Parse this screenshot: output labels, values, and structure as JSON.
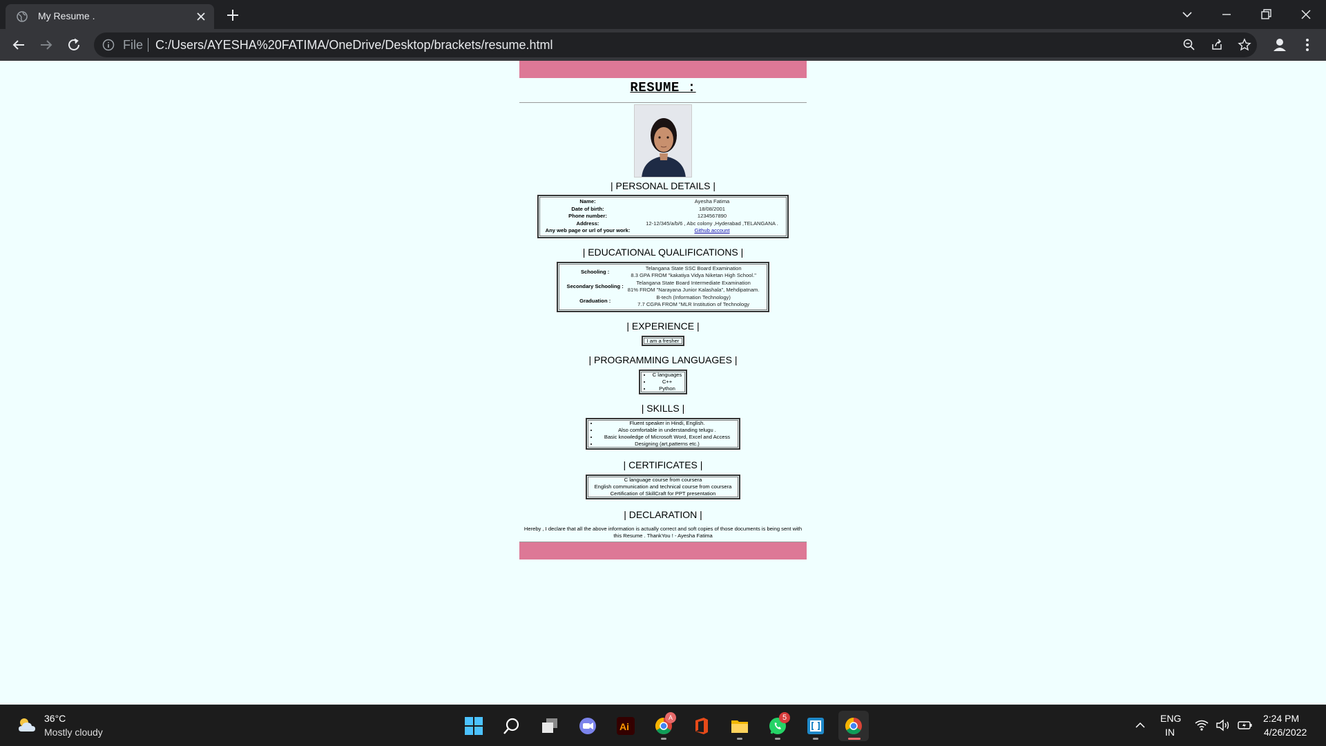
{
  "browser": {
    "tab_title": "My Resume .",
    "omnibox_scheme_label": "File",
    "url": "C:/Users/AYESHA%20FATIMA/OneDrive/Desktop/brackets/resume.html"
  },
  "resume": {
    "title": "RESUME :",
    "accent_color": "#dd7896",
    "personal": {
      "heading": "| PERSONAL DETAILS |",
      "rows": [
        {
          "label": "Name:",
          "value": "Ayesha Fatima"
        },
        {
          "label": "Date of birth:",
          "value": "18/08/2001"
        },
        {
          "label": "Phone number:",
          "value": "1234567890"
        },
        {
          "label": "Address:",
          "value": "12-12/345/a/b/6 , Abc colony ,Hyderabad ,TELANGANA ."
        },
        {
          "label": "Any web page or url of your work:",
          "value": "Github account"
        }
      ]
    },
    "education": {
      "heading": "| EDUCATIONAL QUALIFICATIONS |",
      "rows": [
        {
          "label": "Schooling :",
          "line1": "Telangana State SSC Board Examination",
          "line2": "8.3 GPA FROM \"kakatiya Vidya Niketan High School.\""
        },
        {
          "label": "Secondary Schooling :",
          "line1": "Telangana State Board Intermediate Examination",
          "line2": "81% FROM \"Narayana Junior Kalashala\", Mehdipatnam."
        },
        {
          "label": "Graduation :",
          "line1": "B-tech (Information Technology)",
          "line2": "7.7 CGPA FROM \"MLR Institution of Technology"
        }
      ]
    },
    "experience": {
      "heading": "| EXPERIENCE |",
      "text": "I am a fresher"
    },
    "languages": {
      "heading": "| PROGRAMMING LANGUAGES |",
      "items": [
        "C languages",
        "C++",
        "Python"
      ]
    },
    "skills": {
      "heading": "| SKILLS |",
      "items": [
        "Fluent speaker in Hindi, English.",
        "Also comfortable in understanding telugu .",
        "Basic knowledge of Microsoft Word, Excel and Access",
        "Designing (art,patterns etc.)"
      ]
    },
    "certificates": {
      "heading": "| CERTIFICATES |",
      "items": [
        "C language course from coursera",
        "English communication and technical course from coursera",
        "Certification of SkillCraft for PPT presentation"
      ]
    },
    "declaration": {
      "heading": "| DECLARATION |",
      "text": "Hereby , I declare that all the above information is actually correct and soft copies of those documents is being sent with this Resume . ThankYou ! - Ayesha Fatima"
    }
  },
  "taskbar": {
    "weather_temp": "36°C",
    "weather_desc": "Mostly cloudy",
    "whatsapp_badge": "5",
    "lang_line1": "ENG",
    "lang_line2": "IN",
    "time": "2:24 PM",
    "date": "4/26/2022"
  }
}
